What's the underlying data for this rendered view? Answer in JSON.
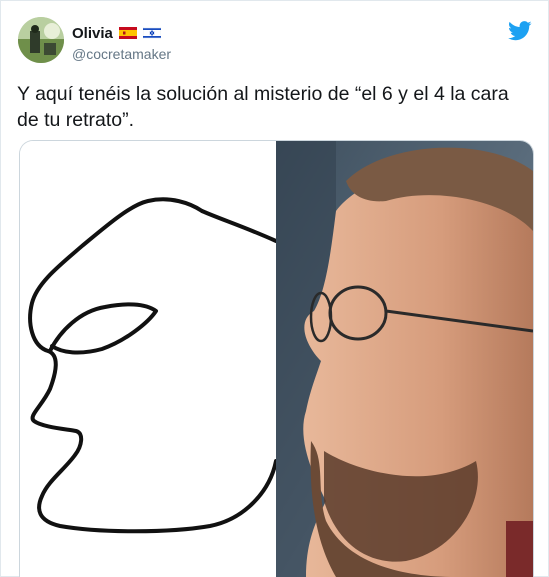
{
  "tweet": {
    "author": {
      "display_name": "Olivia",
      "handle": "@cocretamaker",
      "flag_icons": [
        "spain-flag-icon",
        "israel-flag-icon"
      ]
    },
    "text": "Y aquí tenéis la solución al  misterio de “el 6 y el 4 la cara de tu retrato”.",
    "platform_icon": "twitter-bird-icon",
    "media": {
      "left_image": "line-drawing-face-profile",
      "right_image": "photo-man-profile-glasses"
    }
  },
  "colors": {
    "brand": "#1da1f2",
    "text": "#14171a",
    "secondary": "#657786",
    "border": "#e1e8ed"
  }
}
